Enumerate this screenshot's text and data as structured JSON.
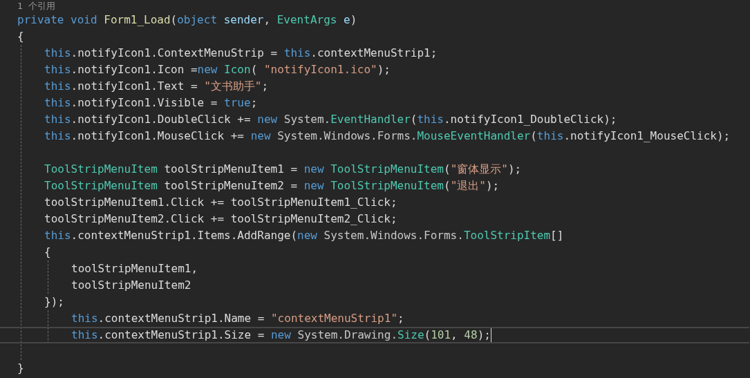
{
  "editor": {
    "lines": [
      {
        "kind": "codelens",
        "text": "1 个引用"
      },
      {
        "kind": "code",
        "current": false,
        "tokens": [
          {
            "kind": "keyword",
            "text": "private"
          },
          {
            "kind": "keyword",
            "text": " void"
          },
          {
            "kind": "method",
            "text": " Form1_Load"
          },
          {
            "kind": "plain",
            "text": "("
          },
          {
            "kind": "keyword",
            "text": "object"
          },
          {
            "kind": "param",
            "text": " sender"
          },
          {
            "kind": "plain",
            "text": ", "
          },
          {
            "kind": "type",
            "text": "EventArgs"
          },
          {
            "kind": "param",
            "text": " e"
          },
          {
            "kind": "plain",
            "text": ")"
          }
        ]
      },
      {
        "kind": "code",
        "current": false,
        "tokens": [
          {
            "kind": "plain",
            "text": "{"
          }
        ],
        "children": [
          {
            "kind": "code",
            "current": false,
            "tokens": [
              {
                "kind": "keyword",
                "text": "this"
              },
              {
                "kind": "plain",
                "text": ".notifyIcon1.ContextMenuStrip = "
              },
              {
                "kind": "keyword",
                "text": "this"
              },
              {
                "kind": "plain",
                "text": ".contextMenuStrip1;"
              }
            ]
          },
          {
            "kind": "code",
            "current": false,
            "tokens": [
              {
                "kind": "keyword",
                "text": "this"
              },
              {
                "kind": "plain",
                "text": ".notifyIcon1.Icon ="
              },
              {
                "kind": "keyword",
                "text": "new"
              },
              {
                "kind": "type",
                "text": " Icon"
              },
              {
                "kind": "plain",
                "text": "( "
              },
              {
                "kind": "string",
                "text": "\"notifyIcon1.ico\""
              },
              {
                "kind": "plain",
                "text": ");"
              }
            ]
          },
          {
            "kind": "code",
            "current": false,
            "tokens": [
              {
                "kind": "keyword",
                "text": "this"
              },
              {
                "kind": "plain",
                "text": ".notifyIcon1.Text = "
              },
              {
                "kind": "string",
                "text": "\"文书助手\""
              },
              {
                "kind": "plain",
                "text": ";"
              }
            ]
          },
          {
            "kind": "code",
            "current": false,
            "tokens": [
              {
                "kind": "keyword",
                "text": "this"
              },
              {
                "kind": "plain",
                "text": ".notifyIcon1.Visible = "
              },
              {
                "kind": "keyword",
                "text": "true"
              },
              {
                "kind": "plain",
                "text": ";"
              }
            ]
          },
          {
            "kind": "code",
            "current": false,
            "tokens": [
              {
                "kind": "keyword",
                "text": "this"
              },
              {
                "kind": "plain",
                "text": ".notifyIcon1.DoubleClick += "
              },
              {
                "kind": "keyword",
                "text": "new"
              },
              {
                "kind": "namespace",
                "text": " System."
              },
              {
                "kind": "type",
                "text": "EventHandler"
              },
              {
                "kind": "plain",
                "text": "("
              },
              {
                "kind": "keyword",
                "text": "this"
              },
              {
                "kind": "plain",
                "text": ".notifyIcon1_DoubleClick);"
              }
            ]
          },
          {
            "kind": "code",
            "current": false,
            "tokens": [
              {
                "kind": "keyword",
                "text": "this"
              },
              {
                "kind": "plain",
                "text": ".notifyIcon1.MouseClick += "
              },
              {
                "kind": "keyword",
                "text": "new"
              },
              {
                "kind": "namespace",
                "text": " System.Windows.Forms."
              },
              {
                "kind": "type",
                "text": "MouseEventHandler"
              },
              {
                "kind": "plain",
                "text": "("
              },
              {
                "kind": "keyword",
                "text": "this"
              },
              {
                "kind": "plain",
                "text": ".notifyIcon1_MouseClick);"
              }
            ]
          },
          {
            "kind": "blank"
          },
          {
            "kind": "code",
            "current": false,
            "tokens": [
              {
                "kind": "type",
                "text": "ToolStripMenuItem"
              },
              {
                "kind": "plain",
                "text": " toolStripMenuItem1 = "
              },
              {
                "kind": "keyword",
                "text": "new"
              },
              {
                "kind": "type",
                "text": " ToolStripMenuItem"
              },
              {
                "kind": "plain",
                "text": "("
              },
              {
                "kind": "string",
                "text": "\"窗体显示\""
              },
              {
                "kind": "plain",
                "text": ");"
              }
            ]
          },
          {
            "kind": "code",
            "current": false,
            "tokens": [
              {
                "kind": "type",
                "text": "ToolStripMenuItem"
              },
              {
                "kind": "plain",
                "text": " toolStripMenuItem2 = "
              },
              {
                "kind": "keyword",
                "text": "new"
              },
              {
                "kind": "type",
                "text": " ToolStripMenuItem"
              },
              {
                "kind": "plain",
                "text": "("
              },
              {
                "kind": "string",
                "text": "\"退出\""
              },
              {
                "kind": "plain",
                "text": ");"
              }
            ]
          },
          {
            "kind": "code",
            "current": false,
            "tokens": [
              {
                "kind": "plain",
                "text": "toolStripMenuItem1.Click += toolStripMenuItem1_Click;"
              }
            ]
          },
          {
            "kind": "code",
            "current": false,
            "tokens": [
              {
                "kind": "plain",
                "text": "toolStripMenuItem2.Click += toolStripMenuItem2_Click;"
              }
            ]
          },
          {
            "kind": "code",
            "current": false,
            "tokens": [
              {
                "kind": "keyword",
                "text": "this"
              },
              {
                "kind": "plain",
                "text": ".contextMenuStrip1.Items.AddRange("
              },
              {
                "kind": "keyword",
                "text": "new"
              },
              {
                "kind": "namespace",
                "text": " System.Windows.Forms."
              },
              {
                "kind": "type",
                "text": "ToolStripItem"
              },
              {
                "kind": "plain",
                "text": "[]"
              }
            ]
          },
          {
            "kind": "code",
            "current": false,
            "tokens": [
              {
                "kind": "plain",
                "text": "{"
              }
            ],
            "children": [
              {
                "kind": "code",
                "current": false,
                "tokens": [
                  {
                    "kind": "plain",
                    "text": "toolStripMenuItem1,"
                  }
                ]
              },
              {
                "kind": "code",
                "current": false,
                "tokens": [
                  {
                    "kind": "plain",
                    "text": "toolStripMenuItem2"
                  }
                ]
              }
            ]
          },
          {
            "kind": "code",
            "current": false,
            "tokens": [
              {
                "kind": "plain",
                "text": "});"
              }
            ],
            "children": [
              {
                "kind": "code",
                "current": false,
                "tokens": [
                  {
                    "kind": "keyword",
                    "text": "this"
                  },
                  {
                    "kind": "plain",
                    "text": ".contextMenuStrip1.Name = "
                  },
                  {
                    "kind": "string",
                    "text": "\"contextMenuStrip1\""
                  },
                  {
                    "kind": "plain",
                    "text": ";"
                  }
                ]
              },
              {
                "kind": "code",
                "current": true,
                "tokens": [
                  {
                    "kind": "keyword",
                    "text": "this"
                  },
                  {
                    "kind": "plain",
                    "text": ".contextMenuStrip1.Size = "
                  },
                  {
                    "kind": "keyword",
                    "text": "new"
                  },
                  {
                    "kind": "namespace",
                    "text": " System.Drawing."
                  },
                  {
                    "kind": "type",
                    "text": "Size"
                  },
                  {
                    "kind": "plain",
                    "text": "("
                  },
                  {
                    "kind": "number",
                    "text": "101"
                  },
                  {
                    "kind": "plain",
                    "text": ", "
                  },
                  {
                    "kind": "number",
                    "text": "48"
                  },
                  {
                    "kind": "plain",
                    "text": ");"
                  }
                ]
              }
            ]
          },
          {
            "kind": "blank"
          }
        ]
      },
      {
        "kind": "code",
        "current": false,
        "tokens": [
          {
            "kind": "plain",
            "text": "}"
          }
        ]
      }
    ]
  }
}
